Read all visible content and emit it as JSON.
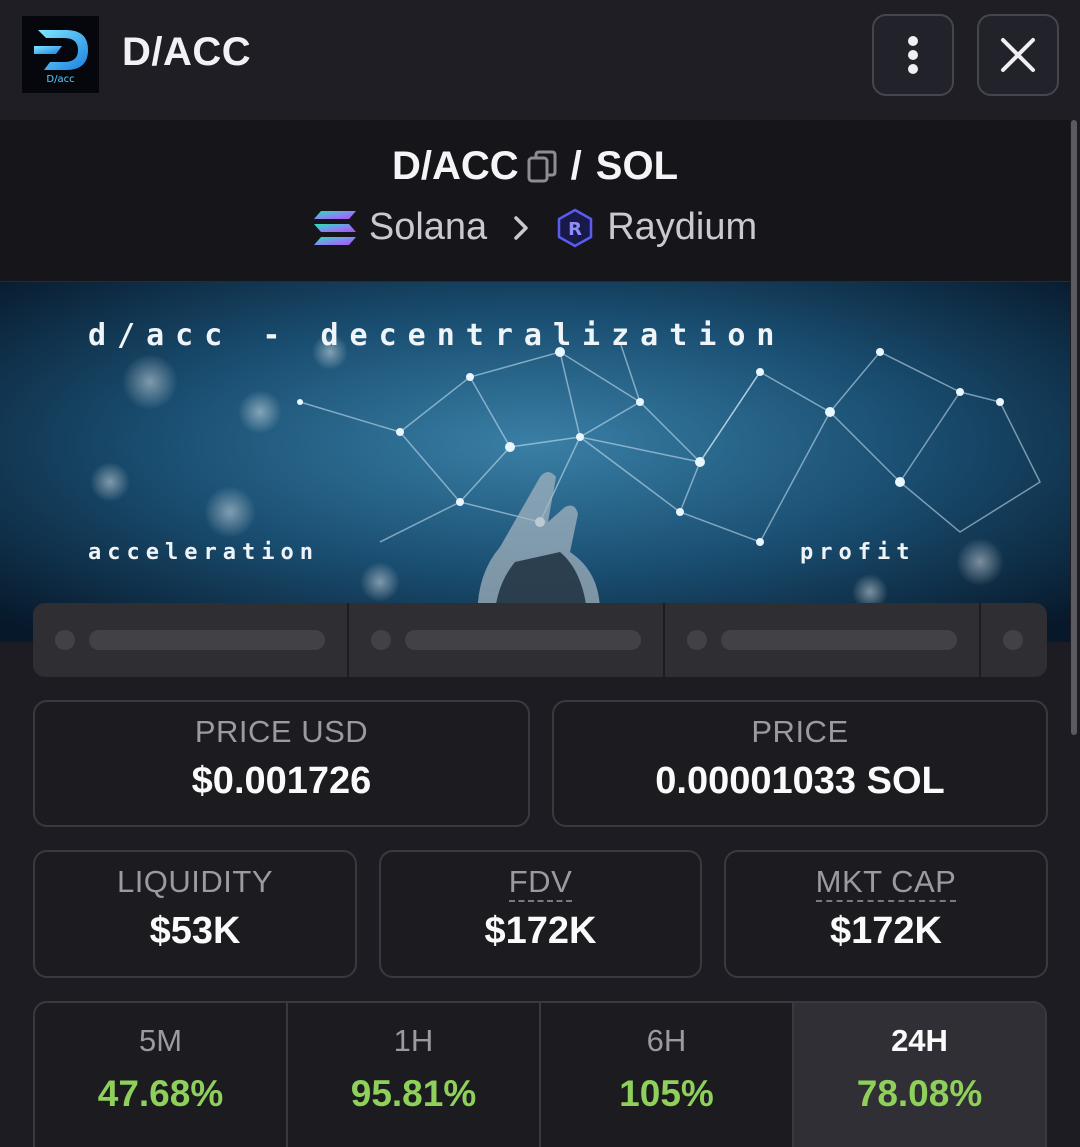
{
  "header": {
    "logo_text": "D/acc",
    "title": "D/ACC",
    "more_icon": "more-vertical-icon",
    "close_icon": "close-icon"
  },
  "pair": {
    "base": "D/ACC",
    "separator": "/",
    "quote": "SOL",
    "chain": "Solana",
    "dex": "Raydium"
  },
  "banner": {
    "title": "d/acc - decentralization",
    "left_caption": "acceleration",
    "right_caption": "profit"
  },
  "stats": {
    "price_usd": {
      "label": "PRICE USD",
      "value": "$0.001726"
    },
    "price": {
      "label": "PRICE",
      "value": "0.00001033 SOL"
    },
    "liquidity": {
      "label": "LIQUIDITY",
      "value": "$53K"
    },
    "fdv": {
      "label": "FDV",
      "value": "$172K"
    },
    "mkt_cap": {
      "label": "MKT CAP",
      "value": "$172K"
    }
  },
  "changes": [
    {
      "label": "5M",
      "value": "47.68%"
    },
    {
      "label": "1H",
      "value": "95.81%"
    },
    {
      "label": "6H",
      "value": "105%"
    },
    {
      "label": "24H",
      "value": "78.08%"
    }
  ],
  "colors": {
    "positive": "#8fd05a",
    "card_border": "#393940",
    "background": "#1c1c22"
  }
}
